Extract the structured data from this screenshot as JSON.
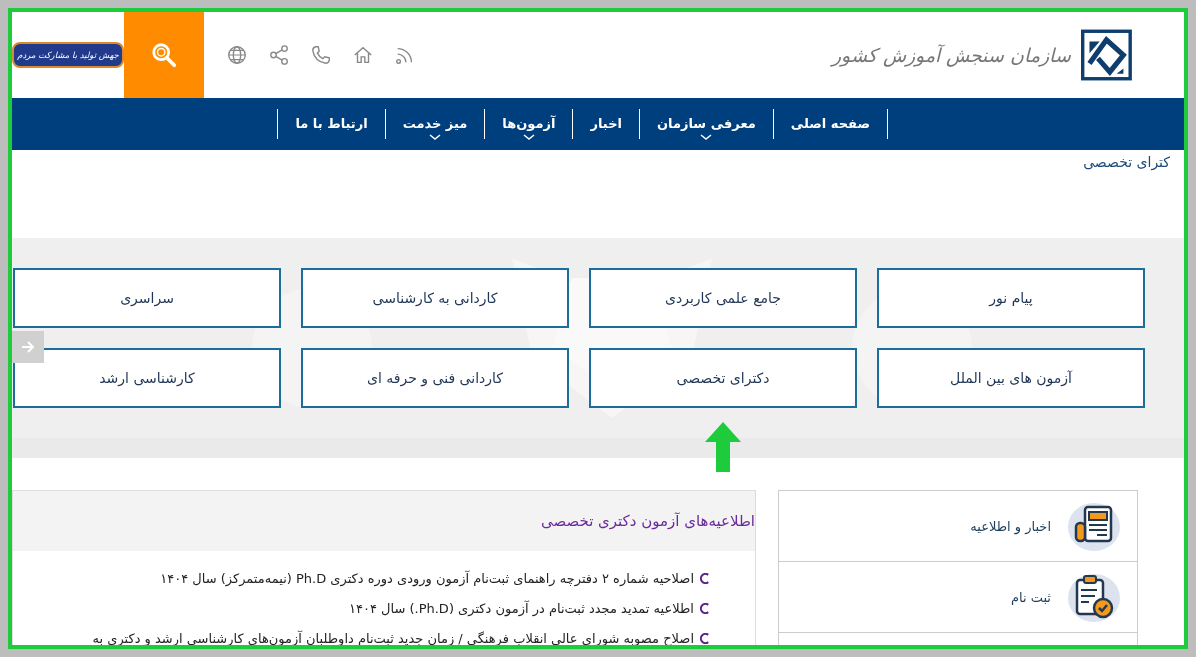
{
  "header": {
    "logo_text": "سازمان سنجش آموزش کشور",
    "banner_text": "جهش تولید با مشارکت مردم"
  },
  "nav": [
    {
      "label": "صفحه اصلی",
      "has_menu": false
    },
    {
      "label": "معرفی سازمان",
      "has_menu": true
    },
    {
      "label": "اخبار",
      "has_menu": false
    },
    {
      "label": "آزمون‌ها",
      "has_menu": true
    },
    {
      "label": "میز خدمت",
      "has_menu": true
    },
    {
      "label": "ارتباط با ما",
      "has_menu": false
    }
  ],
  "breadcrumb": "کترای تخصصی",
  "exam_types": [
    {
      "label": "پیام نور",
      "pointed": false
    },
    {
      "label": "جامع علمی کاربردی",
      "pointed": false
    },
    {
      "label": "کاردانی به کارشناسی",
      "pointed": false
    },
    {
      "label": "سراسری",
      "pointed": false
    },
    {
      "label": "آزمون های بین الملل",
      "pointed": false
    },
    {
      "label": "دکترای تخصصی",
      "pointed": true
    },
    {
      "label": "کاردانی فنی و حرفه ای",
      "pointed": false
    },
    {
      "label": "کارشناسی ارشد",
      "pointed": false
    }
  ],
  "notices": {
    "title": "اطلاعیه‌های آزمون دکتری تخصصی",
    "items": [
      "اصلاحیه شماره ۲ دفترچه راهنمای ثبت‌نام آزمون ورودی دوره دکتری Ph.D (نیمه‌متمرکز) سال ۱۴۰۴",
      "اطلاعیه تمدید مجدد ثبت‌نام در آزمون دکتری (Ph.D.) سال ۱۴۰۴",
      "اصلاح مصوبه شورای عالی انقلاب فرهنگی / زمان جدید ثبت‌نام داوطلبان آزمون‌های کارشناسی ارشد و دکتری به"
    ]
  },
  "side_menu": [
    {
      "label": "اخبار و اطلاعیه",
      "kind": "news"
    },
    {
      "label": "ثبت نام",
      "kind": "register"
    }
  ]
}
